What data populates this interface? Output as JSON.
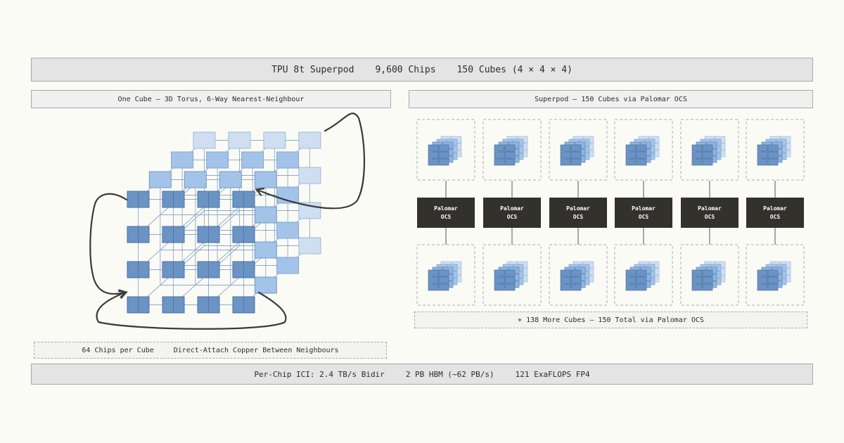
{
  "header": {
    "title": "TPU 8t Superpod",
    "chips": "9,600 Chips",
    "cubes": "150 Cubes (4 × 4 × 4)"
  },
  "cube_panel": {
    "title": "One Cube — 3D Torus, 6-Way Nearest-Neighbour",
    "footer_chips": "64 Chips per Cube",
    "footer_link": "Direct-Attach Copper Between Neighbours"
  },
  "pod_panel": {
    "title": "Superpod — 150 Cubes via Palomar OCS",
    "switch_line1": "Palomar",
    "switch_line2": "OCS",
    "footer": "+ 138 More Cubes — 150 Total via Palomar OCS"
  },
  "specs": {
    "ici": "Per-Chip ICI: 2.4 TB/s Bidir",
    "hbm": "2 PB HBM (~62 PB/s)",
    "flops": "121 ExaFLOPS FP4"
  },
  "colors": {
    "front_chip": "#6b93c4",
    "mid_chip": "#a4c3e8",
    "back_chip": "#cfdff1",
    "switch": "#32312c",
    "arrow": "#3a3a3a"
  },
  "icons": [
    "cube-icon",
    "arrow-icon"
  ]
}
